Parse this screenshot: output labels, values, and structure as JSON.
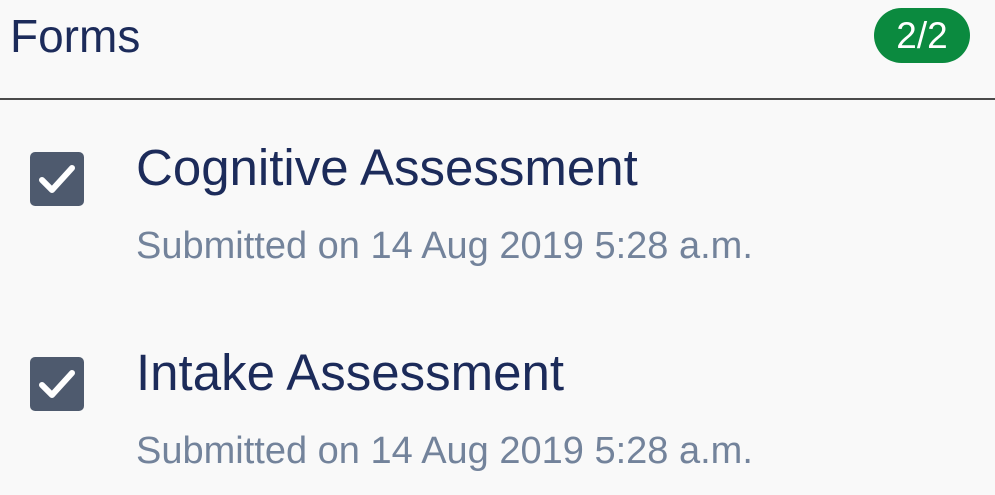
{
  "header": {
    "title": "Forms",
    "count_badge": "2/2",
    "badge_color": "#0b8a3f"
  },
  "forms": [
    {
      "title": "Cognitive Assessment",
      "status": "Submitted on 14 Aug 2019 5:28 a.m.",
      "checked": true,
      "icon": "checkmark-icon"
    },
    {
      "title": "Intake Assessment",
      "status": "Submitted on 14 Aug 2019 5:28 a.m.",
      "checked": true,
      "icon": "checkmark-icon"
    }
  ]
}
